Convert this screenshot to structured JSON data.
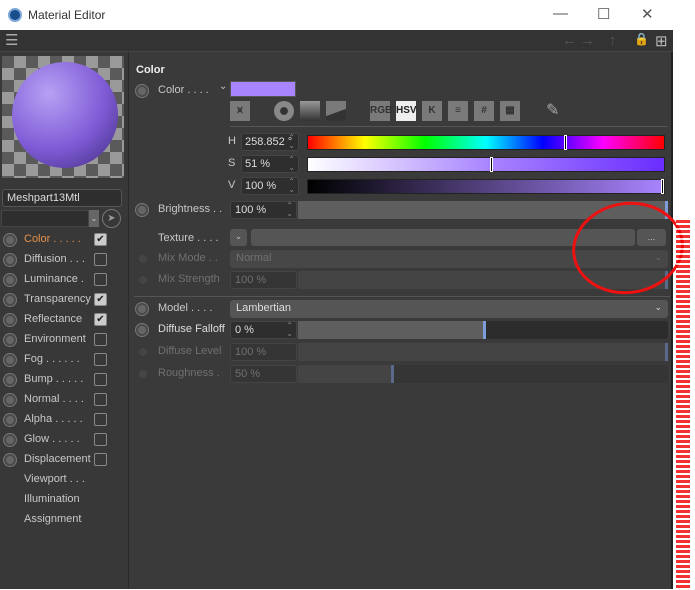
{
  "window": {
    "title": "Material Editor",
    "minimize": "—",
    "maximize": "☐",
    "close": "✕"
  },
  "toolbar": {
    "menu_icon": "hamburger-icon",
    "back": "←",
    "forward": "→",
    "up": "↑",
    "lock": "🔓",
    "new": "⊞"
  },
  "material": {
    "name": "Meshpart13Mtl"
  },
  "channels": [
    {
      "label": "Color . . . . .",
      "checked": true,
      "active": true
    },
    {
      "label": "Diffusion . . .",
      "checked": false
    },
    {
      "label": "Luminance  .",
      "checked": false
    },
    {
      "label": "Transparency",
      "checked": true
    },
    {
      "label": "Reflectance",
      "checked": true
    },
    {
      "label": "Environment",
      "checked": false
    },
    {
      "label": "Fog . . . . . .",
      "checked": false
    },
    {
      "label": "Bump . . . . .",
      "checked": false
    },
    {
      "label": "Normal . . . .",
      "checked": false
    },
    {
      "label": "Alpha . . . . .",
      "checked": false
    },
    {
      "label": "Glow . . . . .",
      "checked": false
    },
    {
      "label": "Displacement",
      "checked": false
    }
  ],
  "extra_items": [
    "Viewport . . .",
    "Illumination",
    "Assignment"
  ],
  "color_section": {
    "title": "Color",
    "color_label": "Color . . . .",
    "swatch": "#a884ff",
    "mode_buttons": [
      "RGB",
      "HSV",
      "K",
      "≡",
      "#",
      "▦"
    ],
    "active_mode": "HSV",
    "h": {
      "label": "H",
      "value": "258.852 °",
      "percent": 71.9
    },
    "s": {
      "label": "S",
      "value": "51 %",
      "percent": 51
    },
    "v": {
      "label": "V",
      "value": "100 %",
      "percent": 100
    },
    "brightness": {
      "label": "Brightness . .",
      "value": "100 %",
      "percent": 100
    },
    "texture": {
      "label": "Texture . . . .",
      "browse": "..."
    },
    "mix_mode": {
      "label": "Mix Mode . .",
      "value": "Normal"
    },
    "mix_strength": {
      "label": "Mix Strength",
      "value": "100 %",
      "percent": 100
    }
  },
  "diffuse": {
    "model": {
      "label": "Model  . . . .",
      "value": "Lambertian"
    },
    "falloff": {
      "label": "Diffuse Falloff",
      "value": "0 %",
      "percent": 50
    },
    "level": {
      "label": "Diffuse Level",
      "value": "100 %",
      "percent": 100
    },
    "roughness": {
      "label": "Roughness  .",
      "value": "50 %",
      "percent": 25
    }
  }
}
